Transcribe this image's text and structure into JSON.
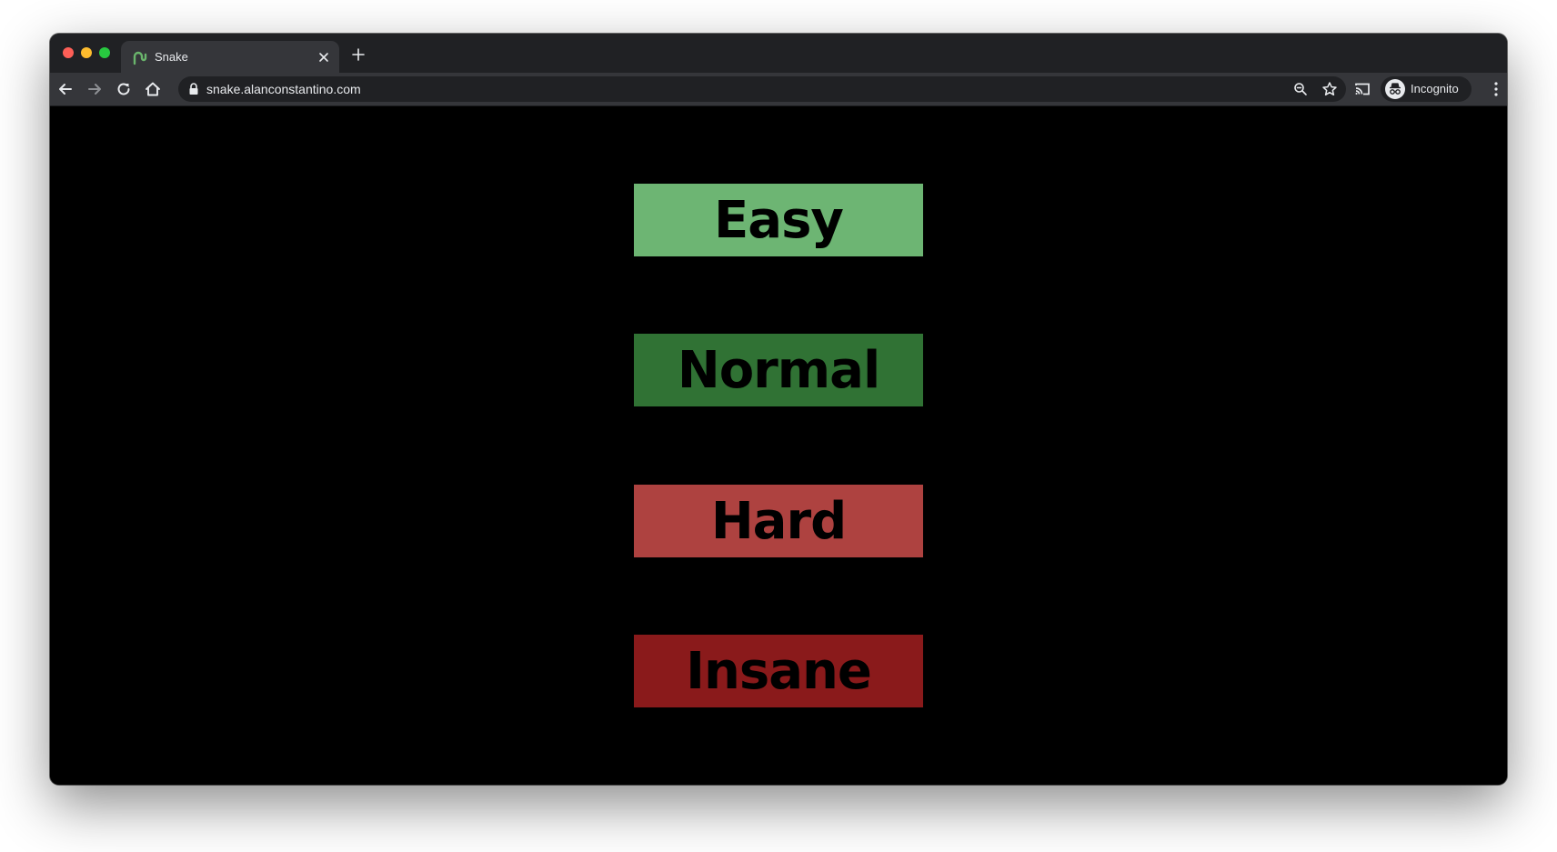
{
  "browser": {
    "tab_title": "Snake",
    "url": "snake.alanconstantino.com",
    "profile_label": "Incognito"
  },
  "menu": {
    "difficulties": [
      {
        "label": "Easy",
        "color": "#6db573"
      },
      {
        "label": "Normal",
        "color": "#307234"
      },
      {
        "label": "Hard",
        "color": "#ae4240"
      },
      {
        "label": "Insane",
        "color": "#8a1a1b"
      }
    ]
  },
  "colors": {
    "chrome_dark": "#202124",
    "chrome_mid": "#35363a",
    "page_background": "#000000",
    "favicon": "#6ab56c"
  },
  "icons": {
    "back": "arrow-left",
    "forward": "arrow-right",
    "reload": "refresh",
    "home": "home",
    "lock": "lock",
    "zoom": "magnifier",
    "bookmark": "star",
    "cast": "cast",
    "incognito": "incognito",
    "menu": "three-dots"
  }
}
